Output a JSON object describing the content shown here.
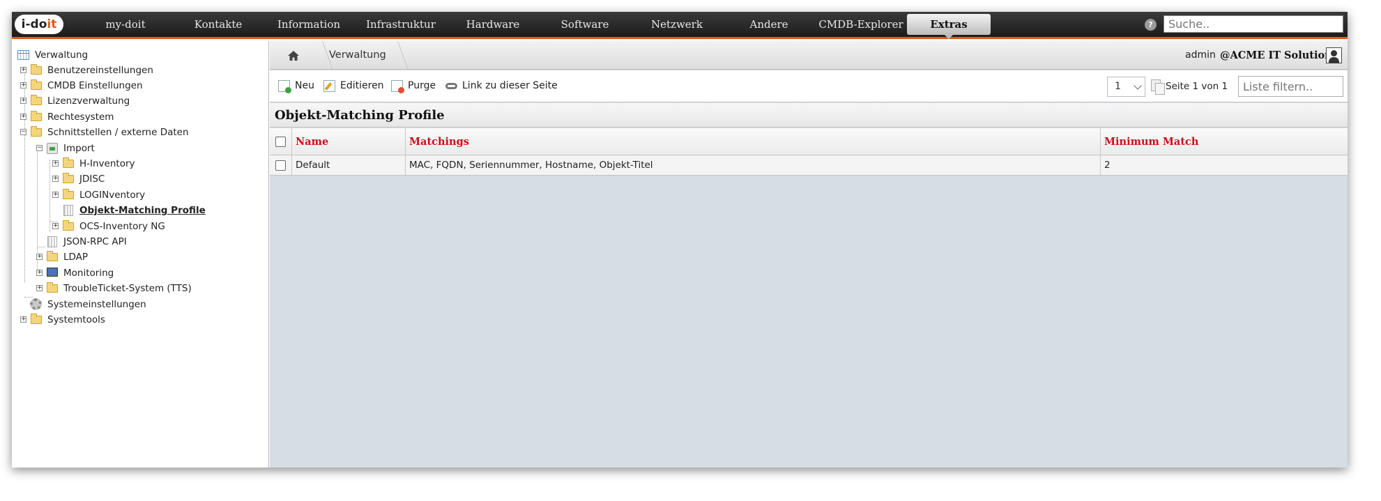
{
  "topbar": {
    "logo": {
      "prefix": "i-do",
      "suffix": "it"
    },
    "nav": [
      {
        "label": "my-doit",
        "width": 138
      },
      {
        "label": "Kontakte",
        "width": 128
      },
      {
        "label": "Information",
        "width": 132
      },
      {
        "label": "Infrastruktur",
        "width": 132
      },
      {
        "label": "Hardware",
        "width": 132
      },
      {
        "label": "Software",
        "width": 132
      },
      {
        "label": "Netzwerk",
        "width": 132
      },
      {
        "label": "Andere",
        "width": 132
      },
      {
        "label": "CMDB-Explorer",
        "width": 132
      },
      {
        "label": "Extras",
        "width": 120,
        "active": true
      }
    ],
    "search_placeholder": "Suche.."
  },
  "sidebar": {
    "root": "Verwaltung",
    "items": {
      "benutzer": "Benutzereinstellungen",
      "cmdb": "CMDB Einstellungen",
      "lizenz": "Lizenzverwaltung",
      "rechte": "Rechtesystem",
      "schnittstellen": "Schnittstellen / externe Daten",
      "import": "Import",
      "hinventory": "H-Inventory",
      "jdisc": "JDISC",
      "loginventory": "LOGINventory",
      "objektmatching": "Objekt-Matching Profile",
      "ocs": "OCS-Inventory NG",
      "jsonrpc": "JSON-RPC API",
      "ldap": "LDAP",
      "monitoring": "Monitoring",
      "tts": "TroubleTicket-System (TTS)",
      "systemeinstellungen": "Systemeinstellungen",
      "systemtools": "Systemtools"
    }
  },
  "breadcrumb": {
    "current": "Verwaltung"
  },
  "user": {
    "name": "admin",
    "tenant": "@ACME IT Solutions"
  },
  "toolbar": {
    "new_label": "Neu",
    "edit_label": "Editieren",
    "purge_label": "Purge",
    "link_label": "Link zu dieser Seite",
    "page_select": "1",
    "page_info": "Seite 1 von 1",
    "filter_placeholder": "Liste filtern.."
  },
  "section": {
    "title": "Objekt-Matching Profile"
  },
  "table": {
    "headers": {
      "name": "Name",
      "matchings": "Matchings",
      "min_match": "Minimum Match"
    },
    "rows": [
      {
        "name": "Default",
        "matchings": "MAC, FQDN, Seriennummer, Hostname, Objekt-Titel",
        "min_match": "2"
      }
    ]
  },
  "colors": {
    "accent": "#e05a1a",
    "header_text": "#c8101a",
    "content_bg": "#d7dde4"
  }
}
